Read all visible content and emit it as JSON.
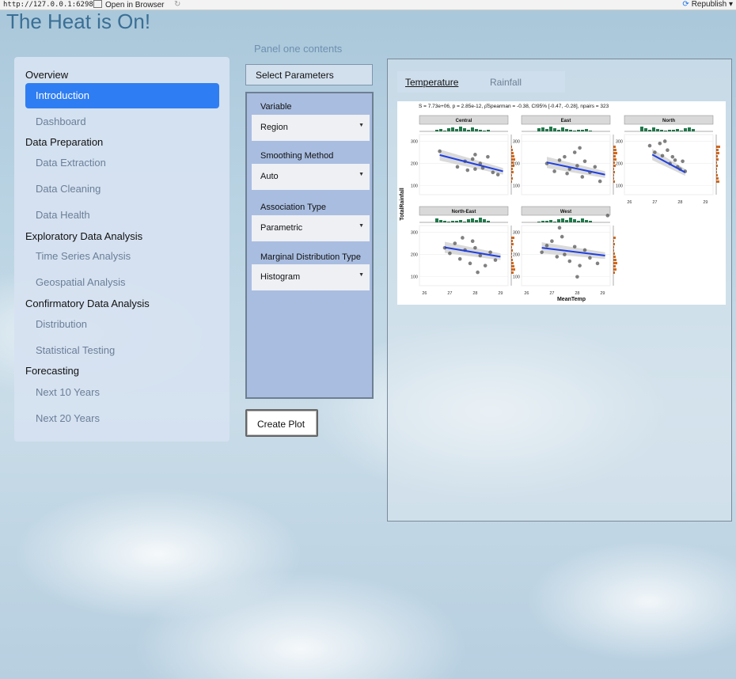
{
  "browser": {
    "url": "http://127.0.0.1:6298",
    "open_in_browser": "Open in Browser",
    "republish": "Republish"
  },
  "app": {
    "title": "The Heat is On!"
  },
  "panel_title": "Panel one contents",
  "sidebar": {
    "groups": [
      {
        "label": "Overview",
        "items": [
          "Introduction",
          "Dashboard"
        ]
      },
      {
        "label": "Data Preparation",
        "items": [
          "Data Extraction",
          "Data Cleaning",
          "Data Health"
        ]
      },
      {
        "label": "Exploratory Data Analysis",
        "items": [
          "Time Series Analysis",
          "Geospatial Analysis"
        ]
      },
      {
        "label": "Confirmatory Data Analysis",
        "items": [
          "Distribution",
          "Statistical Testing"
        ]
      },
      {
        "label": "Forecasting",
        "items": [
          "Next 10 Years",
          "Next 20 Years"
        ]
      }
    ],
    "active_item": "Introduction",
    "active_color": "#2f7df2"
  },
  "params": {
    "header": "Select Parameters",
    "fields": [
      {
        "label": "Variable",
        "value": "Region"
      },
      {
        "label": "Smoothing Method",
        "value": "Auto"
      },
      {
        "label": "Association Type",
        "value": "Parametric"
      },
      {
        "label": "Marginal Distribution Type",
        "value": "Histogram"
      }
    ],
    "create_button": "Create Plot"
  },
  "output": {
    "tabs": [
      "Temperature",
      "Rainfall"
    ],
    "active_tab": "Temperature"
  },
  "chart_data": {
    "type": "scatter",
    "subtitle": "S = 7.73e+06, p = 2.85e-12, ρ̂Spearman = -0.38, CI95% [-0.47, -0.28], npairs = 323",
    "xlabel": "MeanTemp",
    "ylabel": "TotalRainfall",
    "x_ticks": [
      26,
      27,
      28,
      29
    ],
    "y_ticks": [
      100,
      200,
      300
    ],
    "panels": [
      {
        "name": "Central",
        "points": [
          [
            26.6,
            255
          ],
          [
            27.3,
            185
          ],
          [
            27.6,
            210
          ],
          [
            27.9,
            220
          ],
          [
            28.0,
            175
          ],
          [
            28.2,
            200
          ],
          [
            28.3,
            180
          ],
          [
            28.5,
            230
          ],
          [
            28.7,
            160
          ],
          [
            28.9,
            150
          ],
          [
            28.0,
            240
          ],
          [
            27.7,
            170
          ]
        ],
        "fit": [
          [
            26.6,
            238
          ],
          [
            29.1,
            165
          ]
        ]
      },
      {
        "name": "East",
        "points": [
          [
            26.8,
            200
          ],
          [
            27.1,
            165
          ],
          [
            27.3,
            215
          ],
          [
            27.5,
            230
          ],
          [
            27.7,
            175
          ],
          [
            27.9,
            250
          ],
          [
            28.0,
            190
          ],
          [
            28.2,
            140
          ],
          [
            28.3,
            210
          ],
          [
            28.5,
            160
          ],
          [
            28.7,
            185
          ],
          [
            28.9,
            120
          ],
          [
            27.6,
            155
          ],
          [
            28.1,
            270
          ]
        ],
        "fit": [
          [
            26.8,
            205
          ],
          [
            29.1,
            150
          ]
        ]
      },
      {
        "name": "North",
        "points": [
          [
            26.8,
            280
          ],
          [
            27.0,
            250
          ],
          [
            27.2,
            290
          ],
          [
            27.3,
            235
          ],
          [
            27.5,
            260
          ],
          [
            27.6,
            200
          ],
          [
            27.7,
            230
          ],
          [
            27.8,
            215
          ],
          [
            27.9,
            185
          ],
          [
            28.0,
            175
          ],
          [
            28.1,
            210
          ],
          [
            28.2,
            165
          ],
          [
            27.4,
            300
          ]
        ],
        "fit": [
          [
            26.9,
            240
          ],
          [
            28.2,
            160
          ]
        ]
      },
      {
        "name": "North-East",
        "points": [
          [
            26.8,
            230
          ],
          [
            27.0,
            205
          ],
          [
            27.2,
            250
          ],
          [
            27.4,
            180
          ],
          [
            27.6,
            220
          ],
          [
            27.8,
            160
          ],
          [
            28.0,
            230
          ],
          [
            28.2,
            195
          ],
          [
            28.4,
            150
          ],
          [
            28.6,
            210
          ],
          [
            28.8,
            175
          ],
          [
            27.5,
            275
          ],
          [
            28.1,
            120
          ],
          [
            27.9,
            260
          ]
        ],
        "fit": [
          [
            26.8,
            232
          ],
          [
            29.0,
            190
          ]
        ]
      },
      {
        "name": "West",
        "points": [
          [
            26.6,
            210
          ],
          [
            26.8,
            240
          ],
          [
            27.0,
            260
          ],
          [
            27.2,
            190
          ],
          [
            27.4,
            280
          ],
          [
            27.5,
            200
          ],
          [
            27.7,
            170
          ],
          [
            27.9,
            235
          ],
          [
            28.1,
            150
          ],
          [
            28.3,
            220
          ],
          [
            28.5,
            185
          ],
          [
            28.8,
            160
          ],
          [
            27.3,
            320
          ],
          [
            28.0,
            100
          ],
          [
            29.2,
            375
          ]
        ],
        "fit": [
          [
            26.6,
            230
          ],
          [
            29.1,
            195
          ]
        ]
      }
    ],
    "point_color": "#555555",
    "fit_color": "#1f3fe0",
    "top_hist_color": "#1f7a4a",
    "side_hist_color": "#d2691e"
  }
}
